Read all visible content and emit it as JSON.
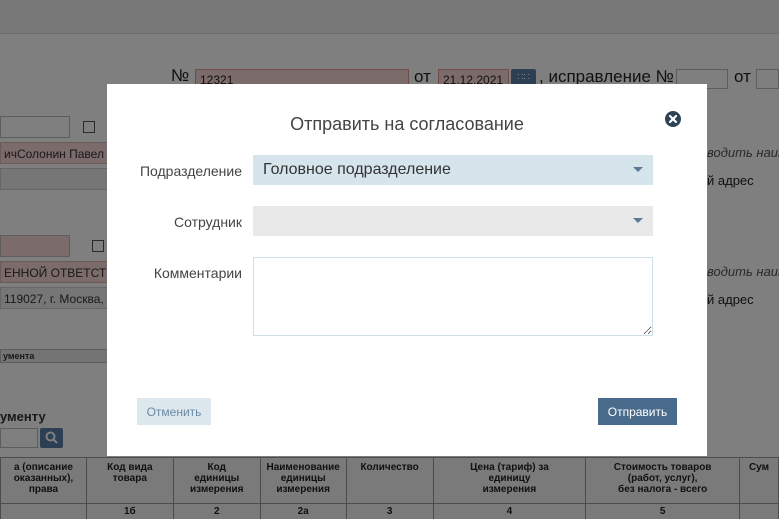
{
  "background": {
    "number_sign": "№",
    "doc_number": "12321",
    "from_label": "от",
    "doc_date": "21.12.2021",
    "correction_label": ", исправление №",
    "correction_from_label": "от",
    "seller_name": "ичСолонин Павел Н",
    "hint_text_1": "водить наим",
    "address_hint_1": "й адрес",
    "buyer_name": "ЕННОЙ ОТВЕТСТВ",
    "hint_text_2": "водить наим",
    "buyer_address": "119027, г. Москва,",
    "address_hint_2": "й адрес",
    "doc_header_small": "умента",
    "section_title": "ументу",
    "table": {
      "headers": [
        "а (описание\nоказанных),\nправа",
        "Код вида товара",
        "Код\nединицы\nизмерения",
        "Наименование\nединицы\nизмерения",
        "Количество",
        "Цена (тариф) за\nединицу\nизмерения",
        "Стоимость товаров\n(работ, услуг),\nбез налога - всего",
        "Сум"
      ],
      "numbers": [
        "",
        "1б",
        "2",
        "2а",
        "3",
        "4",
        "5",
        ""
      ]
    }
  },
  "modal": {
    "title": "Отправить на согласование",
    "division_label": "Подразделение",
    "division_value": "Головное подразделение",
    "employee_label": "Сотрудник",
    "employee_value": "",
    "comments_label": "Комментарии",
    "comments_value": "",
    "cancel_label": "Отменить",
    "submit_label": "Отправить"
  }
}
